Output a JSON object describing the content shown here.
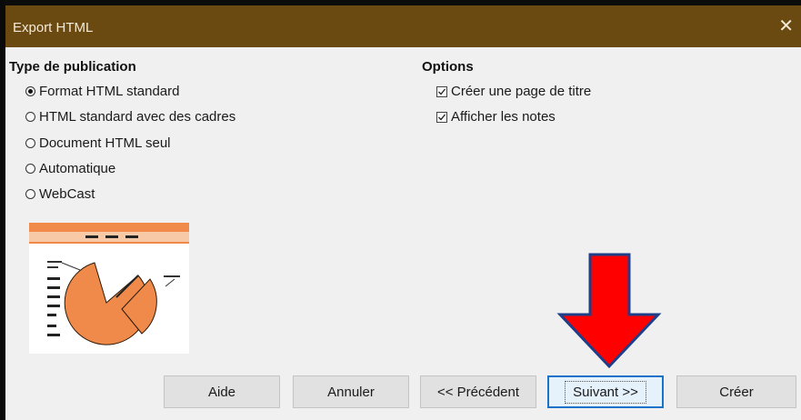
{
  "window": {
    "title": "Export HTML"
  },
  "publication": {
    "heading": "Type de publication",
    "options": [
      {
        "label": "Format HTML standard",
        "checked": true
      },
      {
        "label": "HTML standard avec des cadres",
        "checked": false
      },
      {
        "label": "Document HTML seul",
        "checked": false
      },
      {
        "label": "Automatique",
        "checked": false
      },
      {
        "label": "WebCast",
        "checked": false
      }
    ]
  },
  "options": {
    "heading": "Options",
    "items": [
      {
        "label": "Créer une page de titre",
        "checked": true
      },
      {
        "label": "Afficher les notes",
        "checked": true
      }
    ]
  },
  "buttons": {
    "help": "Aide",
    "cancel": "Annuler",
    "previous": "<< Précédent",
    "next": "Suivant >>",
    "create": "Créer"
  },
  "colors": {
    "titlebar": "#6b4a12",
    "accent_orange": "#f08a4b",
    "arrow_red": "#ff0000",
    "arrow_outline": "#1f3e8a"
  }
}
